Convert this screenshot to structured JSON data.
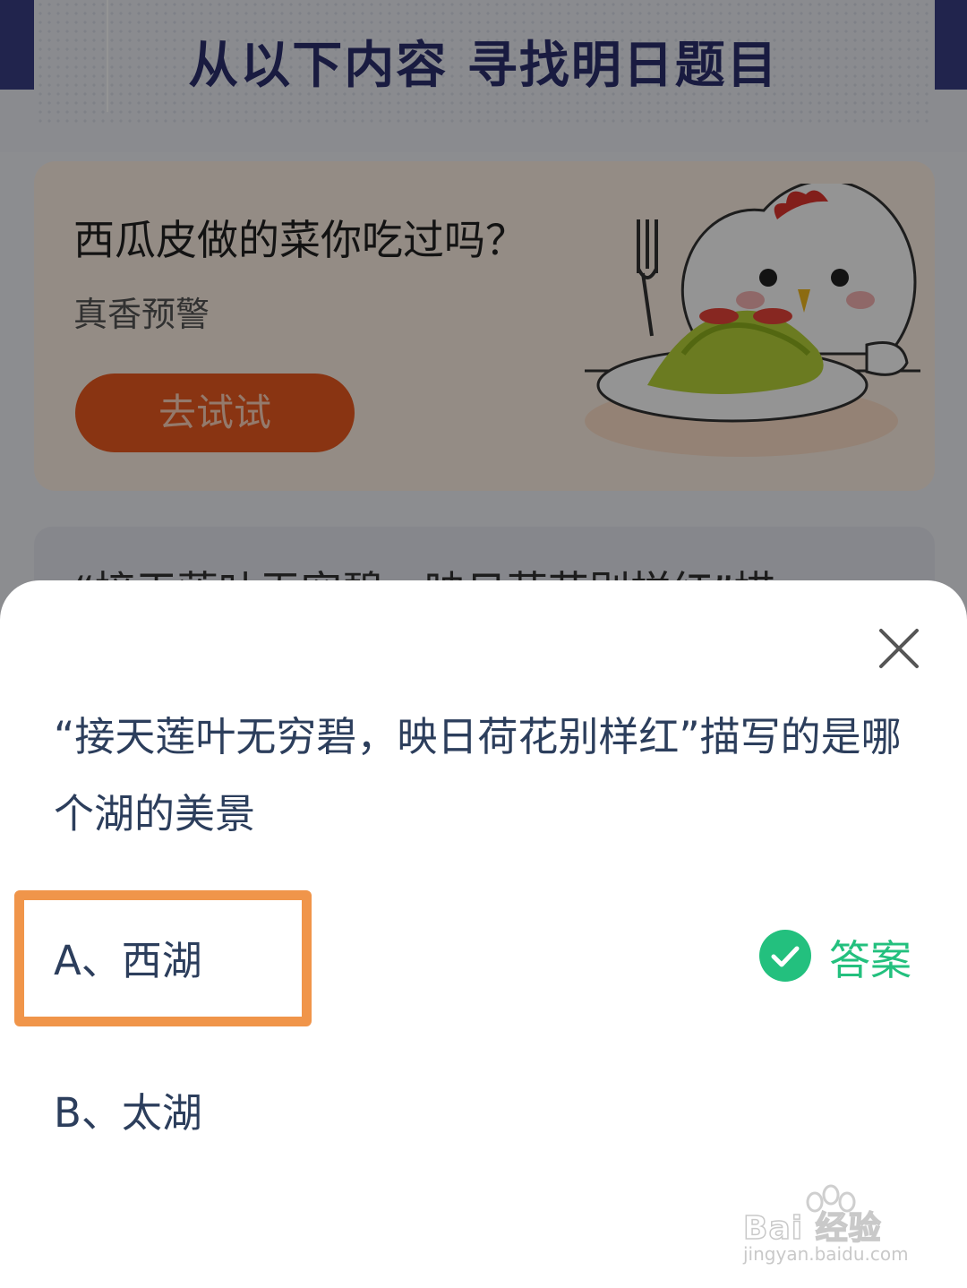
{
  "background": {
    "header_title": "从以下内容  寻找明日题目",
    "card1": {
      "question": "西瓜皮做的菜你吃过吗？",
      "subtitle": "真香预警",
      "button_label": "去试试"
    },
    "card2": {
      "question_peek": "“接天莲叶无穷碧，映日荷花别样红”描"
    }
  },
  "sheet": {
    "question": "“接天莲叶无穷碧，映日荷花别样红”描写的是哪个湖的美景",
    "options": [
      {
        "label": "A、西湖"
      },
      {
        "label": "B、太湖"
      }
    ],
    "answer_label": "答案",
    "close_icon": "close-icon",
    "answer_icon": "check-circle-icon"
  },
  "watermark": {
    "text": "Bai 经验",
    "url_text": "jingyan.baidu.com"
  },
  "colors": {
    "accent_green": "#23c07e",
    "highlight_orange": "#f0954a",
    "question_text": "#2c3e5c",
    "header_navy": "#2b2f6e",
    "button_orange": "#ec5a1f"
  }
}
